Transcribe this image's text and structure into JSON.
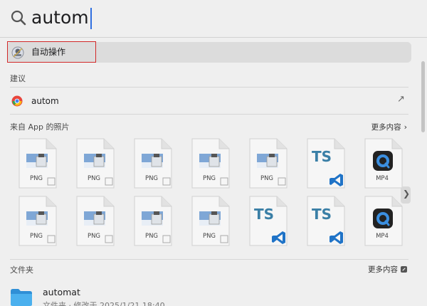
{
  "search": {
    "query": "autom"
  },
  "top_hit": {
    "label": "自动操作",
    "icon": "automator-icon"
  },
  "suggestions": {
    "title": "建议",
    "items": [
      {
        "label": "autom",
        "icon": "chrome-icon",
        "action_icon": "arrow-up-right-icon"
      }
    ]
  },
  "photos": {
    "title": "来自 App 的照片",
    "more_label": "更多内容",
    "rows": [
      [
        {
          "kind": "PNG",
          "label": "PNG"
        },
        {
          "kind": "PNG",
          "label": "PNG"
        },
        {
          "kind": "PNG",
          "label": "PNG"
        },
        {
          "kind": "PNG",
          "label": "PNG"
        },
        {
          "kind": "PNG",
          "label": "PNG"
        },
        {
          "kind": "TS",
          "label": "TS"
        },
        {
          "kind": "MP4",
          "label": "MP4"
        }
      ],
      [
        {
          "kind": "PNG",
          "label": "PNG"
        },
        {
          "kind": "PNG",
          "label": "PNG"
        },
        {
          "kind": "PNG",
          "label": "PNG"
        },
        {
          "kind": "PNG",
          "label": "PNG"
        },
        {
          "kind": "TS",
          "label": "TS"
        },
        {
          "kind": "TS",
          "label": "TS"
        },
        {
          "kind": "MP4",
          "label": "MP4"
        }
      ]
    ]
  },
  "folders": {
    "title": "文件夹",
    "more_label": "更多内容",
    "items": [
      {
        "name": "automat",
        "meta": "文件夹 · 修改于 2025/1/21 18:40"
      }
    ]
  },
  "colors": {
    "highlight_outline": "#d22828",
    "accent": "#2f6fe0",
    "folder": "#3ea7e8"
  }
}
